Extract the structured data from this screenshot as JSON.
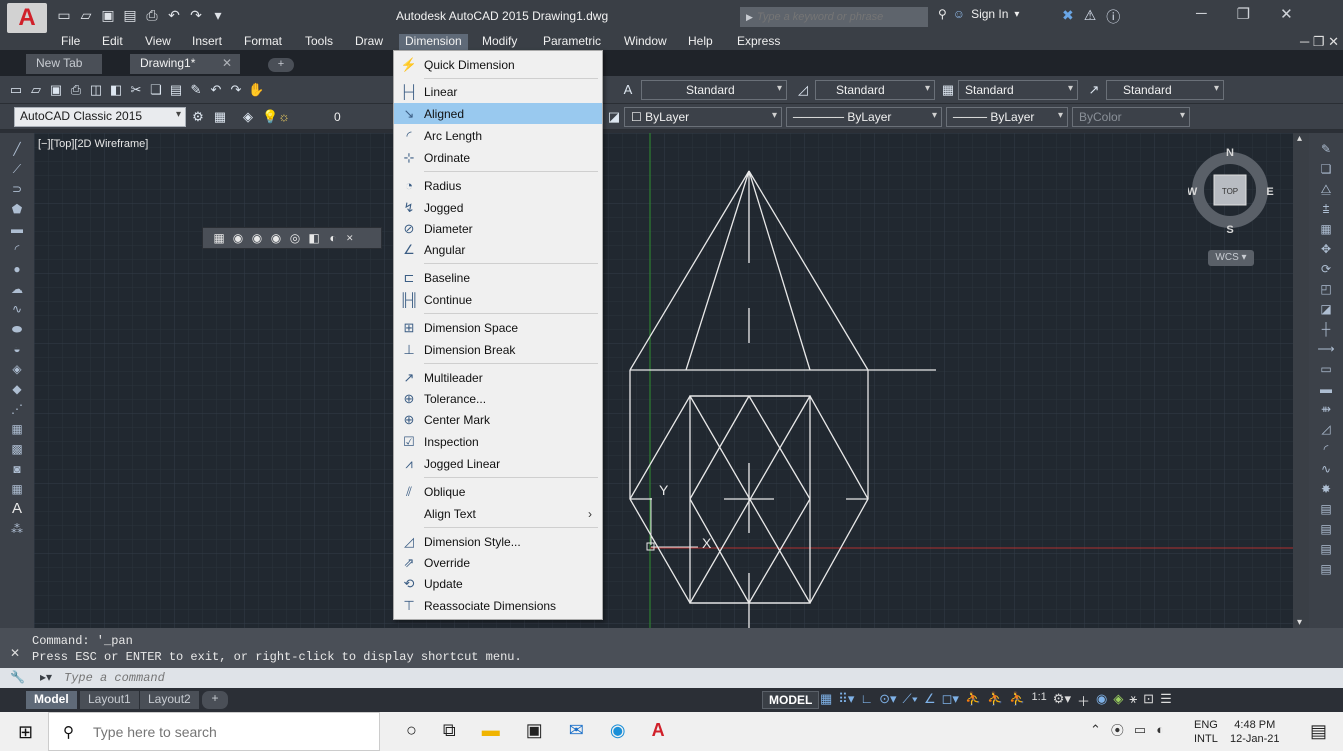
{
  "title_bar": {
    "window_title": "Autodesk AutoCAD 2015   Drawing1.dwg",
    "search_placeholder": "Type a keyword or phrase",
    "sign_in": "Sign In"
  },
  "menu_bar": {
    "items": [
      "File",
      "Edit",
      "View",
      "Insert",
      "Format",
      "Tools",
      "Draw",
      "Dimension",
      "Modify",
      "Parametric",
      "Window",
      "Help",
      "Express"
    ],
    "active": "Dimension"
  },
  "file_tabs": {
    "tabs": [
      "New Tab",
      "Drawing1*"
    ]
  },
  "toolbar_row1": {
    "text_style": "Standard",
    "dim_style": "Standard",
    "table_style": "Standard",
    "multileader_style": "Standard"
  },
  "toolbar_row2": {
    "workspace": "AutoCAD Classic 2015",
    "layer": "0",
    "color": "ByLayer",
    "linetype": "ByLayer",
    "lineweight": "ByLayer",
    "plot_style": "ByColor"
  },
  "viewport": {
    "label": "[−][Top][2D Wireframe]"
  },
  "viewcube": {
    "north": "N",
    "south": "S",
    "east": "E",
    "west": "W",
    "face": "TOP",
    "wcs": "WCS"
  },
  "ucs": {
    "x_label": "X",
    "y_label": "Y"
  },
  "dimension_menu": {
    "items": [
      {
        "icon": "quick-dimension-icon",
        "label": "Quick Dimension"
      },
      {
        "icon": "linear-icon",
        "label": "Linear"
      },
      {
        "icon": "aligned-icon",
        "label": "Aligned"
      },
      {
        "icon": "arc-length-icon",
        "label": "Arc Length"
      },
      {
        "icon": "ordinate-icon",
        "label": "Ordinate"
      },
      {
        "icon": "radius-icon",
        "label": "Radius"
      },
      {
        "icon": "jogged-icon",
        "label": "Jogged"
      },
      {
        "icon": "diameter-icon",
        "label": "Diameter"
      },
      {
        "icon": "angular-icon",
        "label": "Angular"
      },
      {
        "icon": "baseline-icon",
        "label": "Baseline"
      },
      {
        "icon": "continue-icon",
        "label": "Continue"
      },
      {
        "icon": "dimension-space-icon",
        "label": "Dimension Space"
      },
      {
        "icon": "dimension-break-icon",
        "label": "Dimension Break"
      },
      {
        "icon": "multileader-icon",
        "label": "Multileader"
      },
      {
        "icon": "tolerance-icon",
        "label": "Tolerance..."
      },
      {
        "icon": "center-mark-icon",
        "label": "Center Mark"
      },
      {
        "icon": "inspection-icon",
        "label": "Inspection"
      },
      {
        "icon": "jogged-linear-icon",
        "label": "Jogged Linear"
      },
      {
        "icon": "oblique-icon",
        "label": "Oblique"
      },
      {
        "icon": "align-text-icon",
        "label": "Align Text"
      },
      {
        "icon": "dimension-style-icon",
        "label": "Dimension Style..."
      },
      {
        "icon": "override-icon",
        "label": "Override"
      },
      {
        "icon": "update-icon",
        "label": "Update"
      },
      {
        "icon": "reassociate-icon",
        "label": "Reassociate Dimensions"
      }
    ],
    "highlighted": "Aligned"
  },
  "command": {
    "history_1": "Command: '_pan",
    "history_2": "Press ESC or ENTER to exit, or right-click to display shortcut menu.",
    "input_placeholder": "Type a command"
  },
  "layout_tabs": {
    "tabs": [
      "Model",
      "Layout1",
      "Layout2"
    ],
    "active": "Model"
  },
  "status_bar": {
    "model_button": "MODEL",
    "scale": "1:1"
  },
  "taskbar": {
    "search_placeholder": "Type here to search",
    "lang_1": "ENG",
    "lang_2": "INTL",
    "time": "4:48 PM",
    "date": "12-Jan-21"
  },
  "colors": {
    "canvas_bg": "#212830",
    "menu_highlight": "#99c9ef",
    "ui_dark": "#3c4149",
    "x_axis": "#b03030",
    "y_axis": "#2f8f2f"
  }
}
